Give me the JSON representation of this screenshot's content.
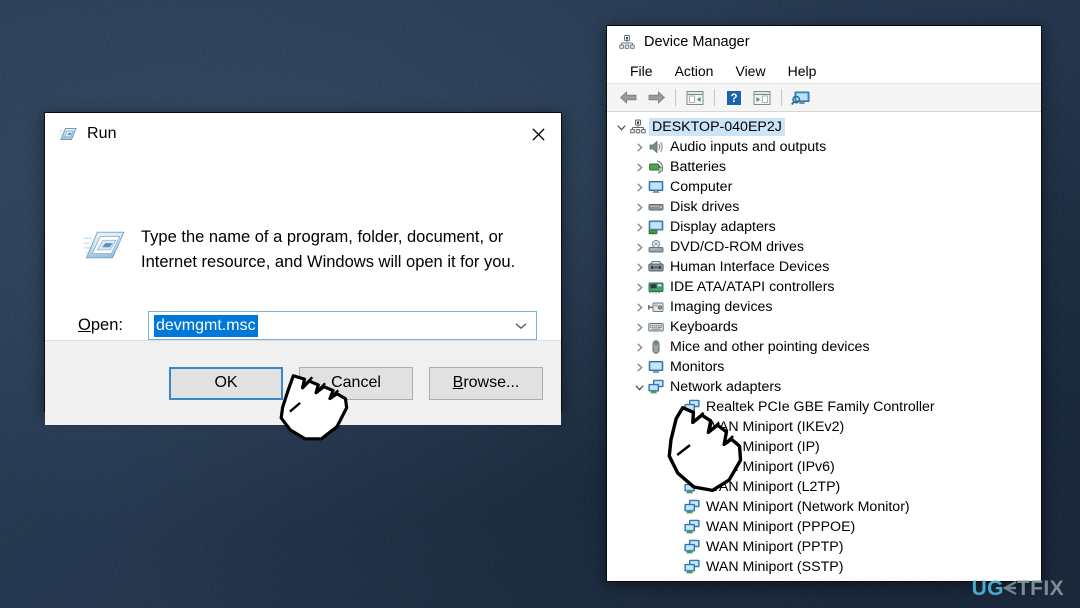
{
  "desktop": {
    "background_color": "#26384f"
  },
  "run_dialog": {
    "title": "Run",
    "title_icon": "run-icon",
    "close_label": "Close",
    "description": "Type the name of a program, folder, document, or Internet resource, and Windows will open it for you.",
    "description_line1": "Type the name of a program, folder, document, or",
    "description_line2": "Internet resource, and Windows will open it for you.",
    "open_label": "Open:",
    "open_label_accelerator": "O",
    "open_value": "devmgmt.msc",
    "open_placeholder": "",
    "selection_color": "#0078d7",
    "focus_border_color": "#3a87c8",
    "buttons": [
      {
        "label": "OK",
        "name": "ok-button",
        "default": true
      },
      {
        "label": "Cancel",
        "name": "cancel-button",
        "default": false
      },
      {
        "label": "Browse...",
        "name": "browse-button",
        "default": false,
        "accelerator": "B"
      }
    ]
  },
  "device_manager": {
    "title": "Device Manager",
    "title_icon": "device-manager-icon",
    "menu": [
      {
        "label": "File",
        "name": "menu-file"
      },
      {
        "label": "Action",
        "name": "menu-action"
      },
      {
        "label": "View",
        "name": "menu-view"
      },
      {
        "label": "Help",
        "name": "menu-help"
      }
    ],
    "toolbar": [
      {
        "name": "back-arrow-icon",
        "label": "Back"
      },
      {
        "name": "forward-arrow-icon",
        "label": "Forward"
      },
      {
        "name": "properties-icon",
        "label": "Properties"
      },
      {
        "name": "help-icon",
        "label": "Help"
      },
      {
        "name": "update-driver-icon",
        "label": "Update driver"
      },
      {
        "name": "scan-hardware-icon",
        "label": "Scan for hardware changes"
      }
    ],
    "tree": [
      {
        "label": "DESKTOP-040EP2J",
        "level": 0,
        "expander": "expanded",
        "icon": "computer-root-icon",
        "selected": true
      },
      {
        "label": "Audio inputs and outputs",
        "level": 1,
        "expander": "collapsed",
        "icon": "speaker-icon",
        "selected": false
      },
      {
        "label": "Batteries",
        "level": 1,
        "expander": "collapsed",
        "icon": "battery-icon",
        "selected": false
      },
      {
        "label": "Computer",
        "level": 1,
        "expander": "collapsed",
        "icon": "monitor-icon",
        "selected": false
      },
      {
        "label": "Disk drives",
        "level": 1,
        "expander": "collapsed",
        "icon": "disk-icon",
        "selected": false
      },
      {
        "label": "Display adapters",
        "level": 1,
        "expander": "collapsed",
        "icon": "display-adapter-icon",
        "selected": false
      },
      {
        "label": "DVD/CD-ROM drives",
        "level": 1,
        "expander": "collapsed",
        "icon": "dvd-icon",
        "selected": false
      },
      {
        "label": "Human Interface Devices",
        "level": 1,
        "expander": "collapsed",
        "icon": "hid-icon",
        "selected": false
      },
      {
        "label": "IDE ATA/ATAPI controllers",
        "level": 1,
        "expander": "collapsed",
        "icon": "ide-controller-icon",
        "selected": false
      },
      {
        "label": "Imaging devices",
        "level": 1,
        "expander": "collapsed",
        "icon": "imaging-icon",
        "selected": false
      },
      {
        "label": "Keyboards",
        "level": 1,
        "expander": "collapsed",
        "icon": "keyboard-icon",
        "selected": false
      },
      {
        "label": "Mice and other pointing devices",
        "level": 1,
        "expander": "collapsed",
        "icon": "mouse-icon",
        "selected": false
      },
      {
        "label": "Monitors",
        "level": 1,
        "expander": "collapsed",
        "icon": "monitor-icon",
        "selected": false
      },
      {
        "label": "Network adapters",
        "level": 1,
        "expander": "expanded",
        "icon": "network-adapter-icon",
        "selected": false
      },
      {
        "label": "Realtek PCIe GBE Family Controller",
        "level": 2,
        "expander": "none",
        "icon": "network-adapter-icon",
        "selected": false
      },
      {
        "label": "WAN Miniport (IKEv2)",
        "level": 2,
        "expander": "none",
        "icon": "network-adapter-icon",
        "selected": false
      },
      {
        "label": "WAN Miniport (IP)",
        "level": 2,
        "expander": "none",
        "icon": "network-adapter-icon",
        "selected": false
      },
      {
        "label": "WAN Miniport (IPv6)",
        "level": 2,
        "expander": "none",
        "icon": "network-adapter-icon",
        "selected": false
      },
      {
        "label": "WAN Miniport (L2TP)",
        "level": 2,
        "expander": "none",
        "icon": "network-adapter-icon",
        "selected": false
      },
      {
        "label": "WAN Miniport (Network Monitor)",
        "level": 2,
        "expander": "none",
        "icon": "network-adapter-icon",
        "selected": false
      },
      {
        "label": "WAN Miniport (PPPOE)",
        "level": 2,
        "expander": "none",
        "icon": "network-adapter-icon",
        "selected": false
      },
      {
        "label": "WAN Miniport (PPTP)",
        "level": 2,
        "expander": "none",
        "icon": "network-adapter-icon",
        "selected": false
      },
      {
        "label": "WAN Miniport (SSTP)",
        "level": 2,
        "expander": "none",
        "icon": "network-adapter-icon",
        "selected": false
      }
    ]
  },
  "cursors": [
    {
      "name": "hand-cursor-run-dialog",
      "over": "ok-button"
    },
    {
      "name": "hand-cursor-device-manager",
      "over": "network-adapters-children"
    }
  ],
  "watermark": {
    "part1": "UG",
    "part2": "E",
    "part3": "TFIX",
    "full": "UGETFIX",
    "color_accent": "#4aa8c9",
    "color_gray": "#7e8c93"
  }
}
